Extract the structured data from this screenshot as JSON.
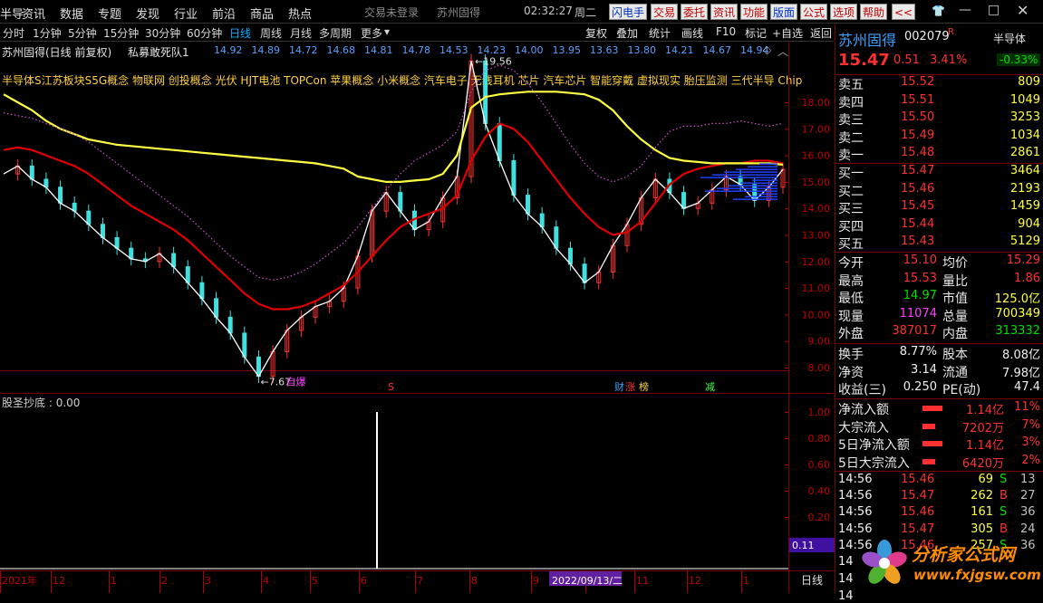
{
  "menu": {
    "items": [
      "半导",
      "资讯",
      "数据",
      "专题",
      "发现",
      "行业",
      "前沿",
      "商品",
      "热点"
    ],
    "center": [
      "交易未登录",
      "苏州固得"
    ],
    "clock": "02:32:27",
    "weekday": "周二",
    "buttons": [
      "闪电手",
      "交易",
      "委托",
      "资讯",
      "功能",
      "版面",
      "公式",
      "选项",
      "帮助"
    ],
    "more": "<<"
  },
  "toolbar": {
    "periods": [
      "分时",
      "1分钟",
      "5分钟",
      "15分钟",
      "30分钟",
      "60分钟",
      "日线",
      "周线",
      "月线",
      "多周期",
      "更多"
    ],
    "selected_period": "日线",
    "more_arrow": "▾",
    "right_buttons": [
      "复权",
      "叠加",
      "统计",
      "画线",
      "F10",
      "标记",
      "+自选",
      "返回"
    ]
  },
  "chart_header": {
    "title": "苏州固得(日线 前复权)",
    "indicator": "私募敢死队1",
    "values": [
      "14.92",
      "14.89",
      "14.72",
      "14.68",
      "14.81",
      "14.78",
      "14.53",
      "14.23",
      "14.00",
      "13.95",
      "13.63",
      "13.80",
      "14.21",
      "14.67",
      "14.94"
    ]
  },
  "concepts": "半导体S江苏板块S5G概念 物联网 创投概念 光伏 HJT电池 TOPCon 苹果概念 小米概念 汽车电子 无线耳机 芯片 汽车芯片 智能穿戴 虚拟现实 胎压监测 三代半导 Chip",
  "price_axis": [
    "18.00",
    "17.00",
    "16.00",
    "15.00",
    "14.00",
    "13.00",
    "12.00",
    "11.00",
    "10.00",
    "9.00",
    "8.00"
  ],
  "annotations": {
    "high": "19.56",
    "low": "7.67",
    "markers": [
      "S",
      "财",
      "涨",
      "榜",
      "减"
    ],
    "low_marker": "自爆"
  },
  "sub_indicator": {
    "name": "股圣抄底",
    "value": "0.00",
    "axis": [
      "1.00",
      "0.80",
      "0.60",
      "0.40",
      "0.20"
    ],
    "right_value": "0.11"
  },
  "date_axis": {
    "labels": [
      "2021年",
      "12",
      "1",
      "2",
      "3",
      "4",
      "5",
      "6",
      "7",
      "8",
      "9",
      "10",
      "11",
      "12",
      "1"
    ],
    "cursor_date": "2022/09/13/二",
    "period_label": "日线"
  },
  "chart_data": {
    "type": "line",
    "title": "",
    "xlabel": "",
    "ylabel": "",
    "ylim": [
      7.5,
      19.8
    ],
    "series": [
      {
        "name": "",
        "color": "#ffffff",
        "values": [
          15.3,
          15.6,
          15.1,
          14.8,
          14.2,
          13.9,
          13.4,
          12.9,
          12.5,
          12.1,
          12.0,
          12.3,
          11.8,
          11.2,
          10.6,
          9.9,
          9.3,
          8.4,
          7.67,
          8.6,
          9.4,
          9.9,
          10.3,
          10.5,
          11.0,
          12.2,
          13.9,
          14.6,
          13.9,
          13.2,
          13.5,
          14.4,
          15.2,
          19.56,
          17.2,
          15.8,
          14.5,
          13.8,
          13.3,
          12.5,
          11.9,
          11.2,
          11.6,
          12.6,
          13.4,
          14.4,
          15.1,
          14.6,
          14.0,
          14.2,
          14.7,
          15.2,
          14.9,
          14.3,
          14.8,
          15.47
        ]
      },
      {
        "name": "",
        "color": "#e00000",
        "values": [
          16.2,
          16.3,
          16.2,
          16.0,
          15.8,
          15.6,
          15.3,
          14.9,
          14.5,
          14.1,
          13.8,
          13.5,
          13.2,
          12.8,
          12.3,
          11.8,
          11.3,
          10.8,
          10.4,
          10.2,
          10.2,
          10.3,
          10.5,
          10.8,
          11.1,
          11.6,
          12.2,
          12.8,
          13.3,
          13.6,
          13.8,
          14.0,
          14.5,
          15.8,
          16.7,
          17.2,
          17.0,
          16.5,
          15.8,
          15.1,
          14.4,
          13.8,
          13.3,
          13.0,
          13.1,
          13.5,
          14.2,
          14.9,
          15.3,
          15.5,
          15.6,
          15.7,
          15.7,
          15.8,
          15.8,
          15.7
        ]
      },
      {
        "name": "",
        "color": "#ffff40",
        "values": [
          18.3,
          18.0,
          17.7,
          17.3,
          17.0,
          16.8,
          16.6,
          16.5,
          16.4,
          16.35,
          16.3,
          16.25,
          16.2,
          16.15,
          16.1,
          16.05,
          16.0,
          15.95,
          15.9,
          15.85,
          15.8,
          15.75,
          15.7,
          15.6,
          15.5,
          15.2,
          15.1,
          15.0,
          15.0,
          15.05,
          15.1,
          15.3,
          16.0,
          17.8,
          18.2,
          18.3,
          18.35,
          18.4,
          18.4,
          18.4,
          18.35,
          18.3,
          18.1,
          17.7,
          17.1,
          16.6,
          16.2,
          15.9,
          15.8,
          15.75,
          15.7,
          15.7,
          15.7,
          15.7,
          15.7,
          15.65
        ]
      },
      {
        "name": "",
        "color": "#d050d0",
        "values": [
          17.6,
          17.5,
          17.4,
          17.2,
          17.0,
          16.8,
          16.5,
          16.1,
          15.7,
          15.3,
          14.9,
          14.5,
          14.1,
          13.7,
          13.2,
          12.7,
          12.2,
          11.8,
          11.4,
          11.3,
          11.4,
          11.6,
          11.9,
          12.3,
          12.7,
          13.3,
          14.0,
          14.7,
          15.3,
          15.8,
          16.1,
          16.4,
          16.9,
          18.4,
          19.2,
          19.4,
          19.2,
          18.7,
          18.0,
          17.2,
          16.4,
          15.7,
          15.2,
          15.0,
          15.2,
          15.6,
          16.3,
          16.9,
          17.1,
          17.1,
          17.2,
          17.2,
          17.3,
          17.2,
          17.1,
          17.2
        ]
      }
    ]
  },
  "quote": {
    "name": "苏州固得",
    "code": "002079",
    "r_mark": "R",
    "sector_btn": "半导体",
    "sector_change": "-0.33%",
    "price": "15.47",
    "change": "0.51",
    "change_pct": "3.41%",
    "asks": [
      [
        "卖五",
        "15.52",
        "809"
      ],
      [
        "卖四",
        "15.51",
        "1049"
      ],
      [
        "卖三",
        "15.50",
        "3253"
      ],
      [
        "卖二",
        "15.49",
        "1034"
      ],
      [
        "卖一",
        "15.48",
        "2861"
      ]
    ],
    "bids": [
      [
        "买一",
        "15.47",
        "3464"
      ],
      [
        "买二",
        "15.46",
        "2193"
      ],
      [
        "买三",
        "15.45",
        "1459"
      ],
      [
        "买四",
        "15.44",
        "904"
      ],
      [
        "买五",
        "15.43",
        "5129"
      ]
    ],
    "stats": [
      [
        "今开",
        "15.10",
        "均价",
        "15.29"
      ],
      [
        "最高",
        "15.53",
        "量比",
        "1.86"
      ],
      [
        "最低",
        "14.97",
        "市值",
        "125.0亿"
      ],
      [
        "现量",
        "11074",
        "总量",
        "700349"
      ],
      [
        "外盘",
        "387017",
        "内盘",
        "313332"
      ]
    ],
    "stats2": [
      [
        "换手",
        "8.77%",
        "股本",
        "8.08亿"
      ],
      [
        "净资",
        "3.14",
        "流通",
        "7.98亿"
      ],
      [
        "收益(三)",
        "0.250",
        "PE(动)",
        "47.4"
      ]
    ],
    "flows": [
      [
        "净流入额",
        "1.14亿",
        "11%"
      ],
      [
        "大宗流入",
        "7202万",
        "7%"
      ],
      [
        "5日净流入额",
        "1.14亿",
        "3%"
      ],
      [
        "5日大宗流入",
        "6420万",
        "2%"
      ]
    ],
    "ticks": [
      [
        "14:56",
        "15.46",
        "69",
        "S",
        "13"
      ],
      [
        "14:56",
        "15.47",
        "262",
        "B",
        "27"
      ],
      [
        "14:56",
        "15.46",
        "161",
        "S",
        "36"
      ],
      [
        "14:56",
        "15.47",
        "305",
        "B",
        "24"
      ],
      [
        "14:56",
        "15.46",
        "257",
        "S",
        "36"
      ]
    ],
    "ticks_extra": [
      "14",
      "14",
      "14"
    ]
  },
  "watermark": {
    "title": "分析家公式网",
    "url": "www.fxjgsw.com"
  }
}
